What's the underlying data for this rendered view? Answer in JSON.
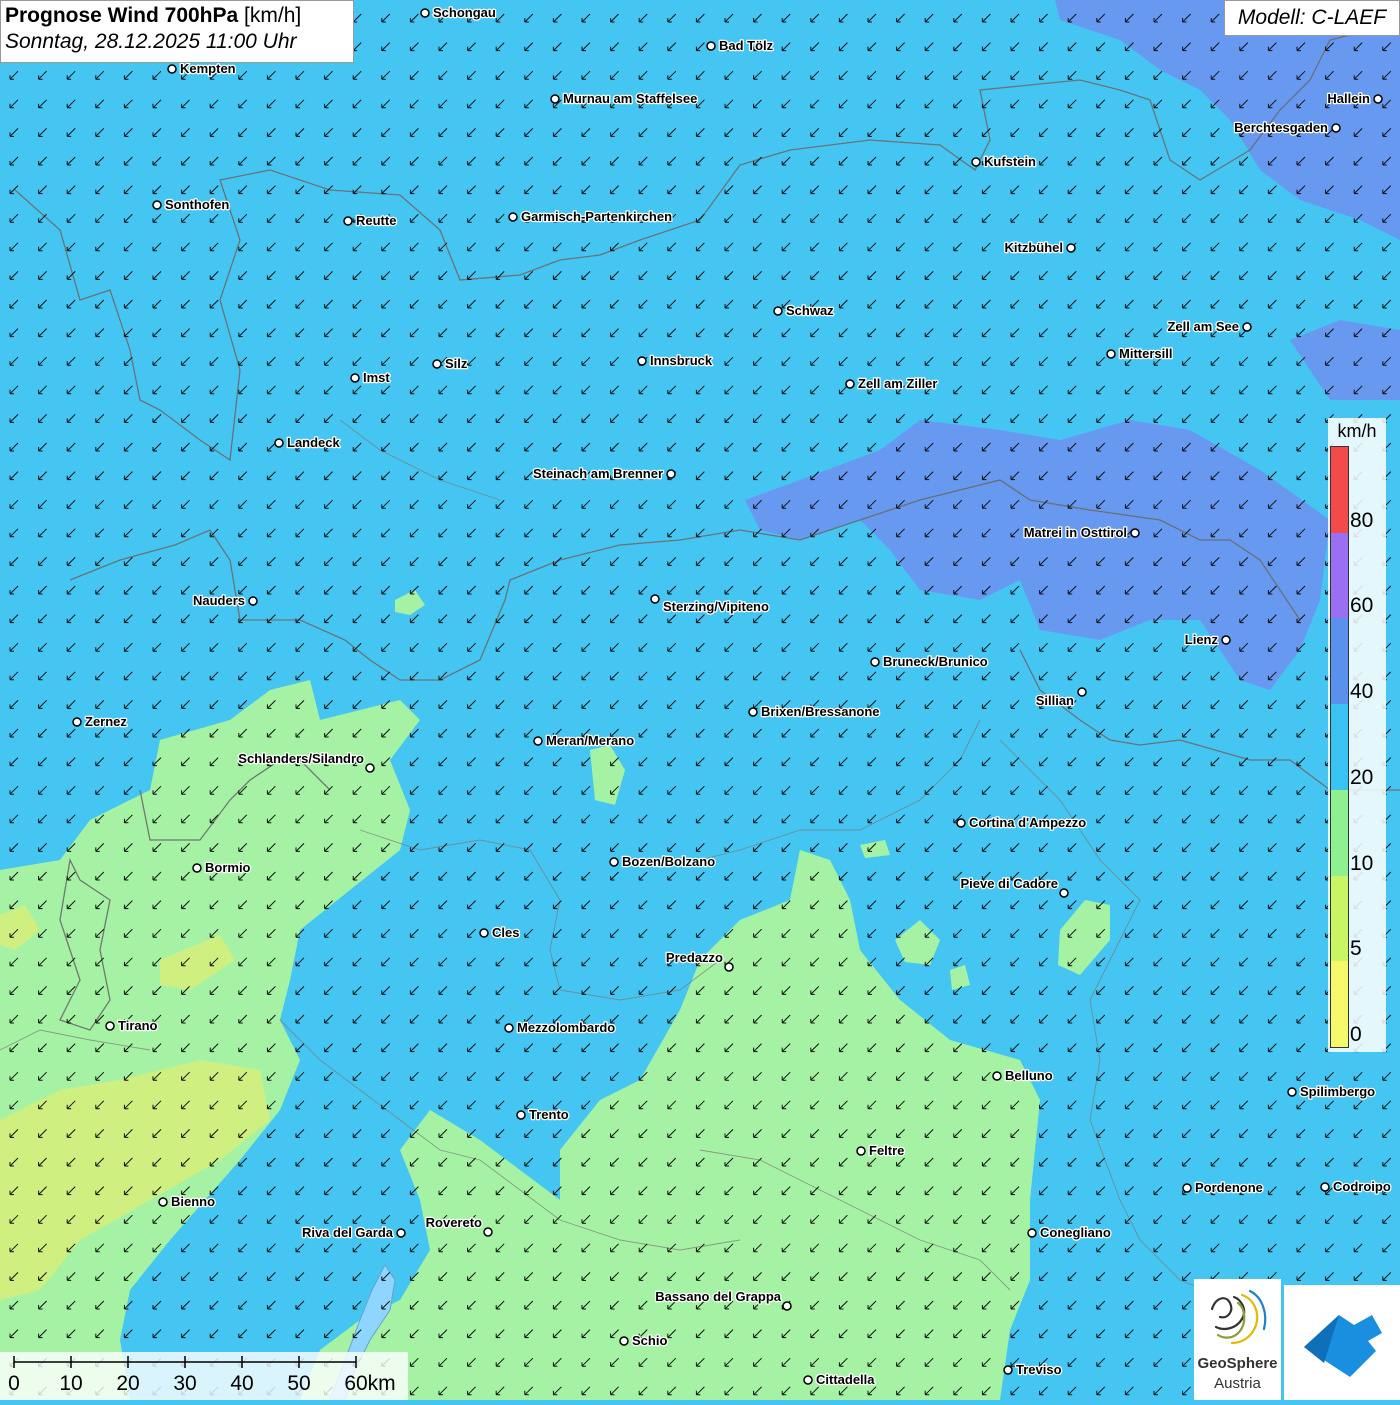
{
  "header": {
    "title_bold": "Prognose Wind 700hPa",
    "title_unit": "[km/h]",
    "datetime": "Sonntag, 28.12.2025 11:00 Uhr"
  },
  "model": "Modell: C-LAEF",
  "legend": {
    "unit": "km/h",
    "segments": [
      {
        "from": 0,
        "to": 5,
        "color": "#f4f86a"
      },
      {
        "from": 5,
        "to": 10,
        "color": "#c9f463"
      },
      {
        "from": 10,
        "to": 20,
        "color": "#8ef08f"
      },
      {
        "from": 20,
        "to": 40,
        "color": "#39c3f3"
      },
      {
        "from": 40,
        "to": 60,
        "color": "#5a91ee"
      },
      {
        "from": 60,
        "to": 80,
        "color": "#9a6ff3"
      },
      {
        "from": 80,
        "to": 100,
        "color": "#f44a4a"
      }
    ],
    "labels": [
      "0",
      "5",
      "10",
      "20",
      "40",
      "60",
      "80"
    ]
  },
  "scale_bar": {
    "labels": [
      "0",
      "10",
      "20",
      "30",
      "40",
      "50",
      "60km"
    ]
  },
  "wind": {
    "direction": "from north-east",
    "colors": {
      "field_20_40": "#45c6f2",
      "field_40_60": "#6a97ef",
      "field_10_20": "#a6f2a4",
      "field_5_10": "#d6f07a"
    }
  },
  "cities": [
    "Schongau",
    "Bad Tölz",
    "Kempten",
    "Murnau am Staffelsee",
    "Hallein",
    "Berchtesgaden",
    "Kufstein",
    "Sonthofen",
    "Reutte",
    "Garmisch-Partenkirchen",
    "Kitzbühel",
    "Schwaz",
    "Zell am See",
    "Mittersill",
    "Innsbruck",
    "Silz",
    "Imst",
    "Zell am Ziller",
    "Landeck",
    "Steinach am Brenner",
    "Matrei in Osttirol",
    "Nauders",
    "Sterzing/Vipiteno",
    "Lienz",
    "Bruneck/Brunico",
    "Sillian",
    "Zernez",
    "Brixen/Bressanone",
    "Meran/Merano",
    "Schlanders/Silandro",
    "Cortina d'Ampezzo",
    "Bozen/Bolzano",
    "Bormio",
    "Pieve di Cadore",
    "Cles",
    "Predazzo",
    "Tirano",
    "Mezzolombardo",
    "Belluno",
    "Spilimbergo",
    "Trento",
    "Feltre",
    "Pordenone",
    "Codroipo",
    "Bienno",
    "Riva del Garda",
    "Rovereto",
    "Conegliano",
    "Bassano del Grappa",
    "Schio",
    "Treviso",
    "Cittadella"
  ],
  "logos": {
    "geosphere_line1": "GeoSphere",
    "geosphere_line2": "Austria"
  }
}
